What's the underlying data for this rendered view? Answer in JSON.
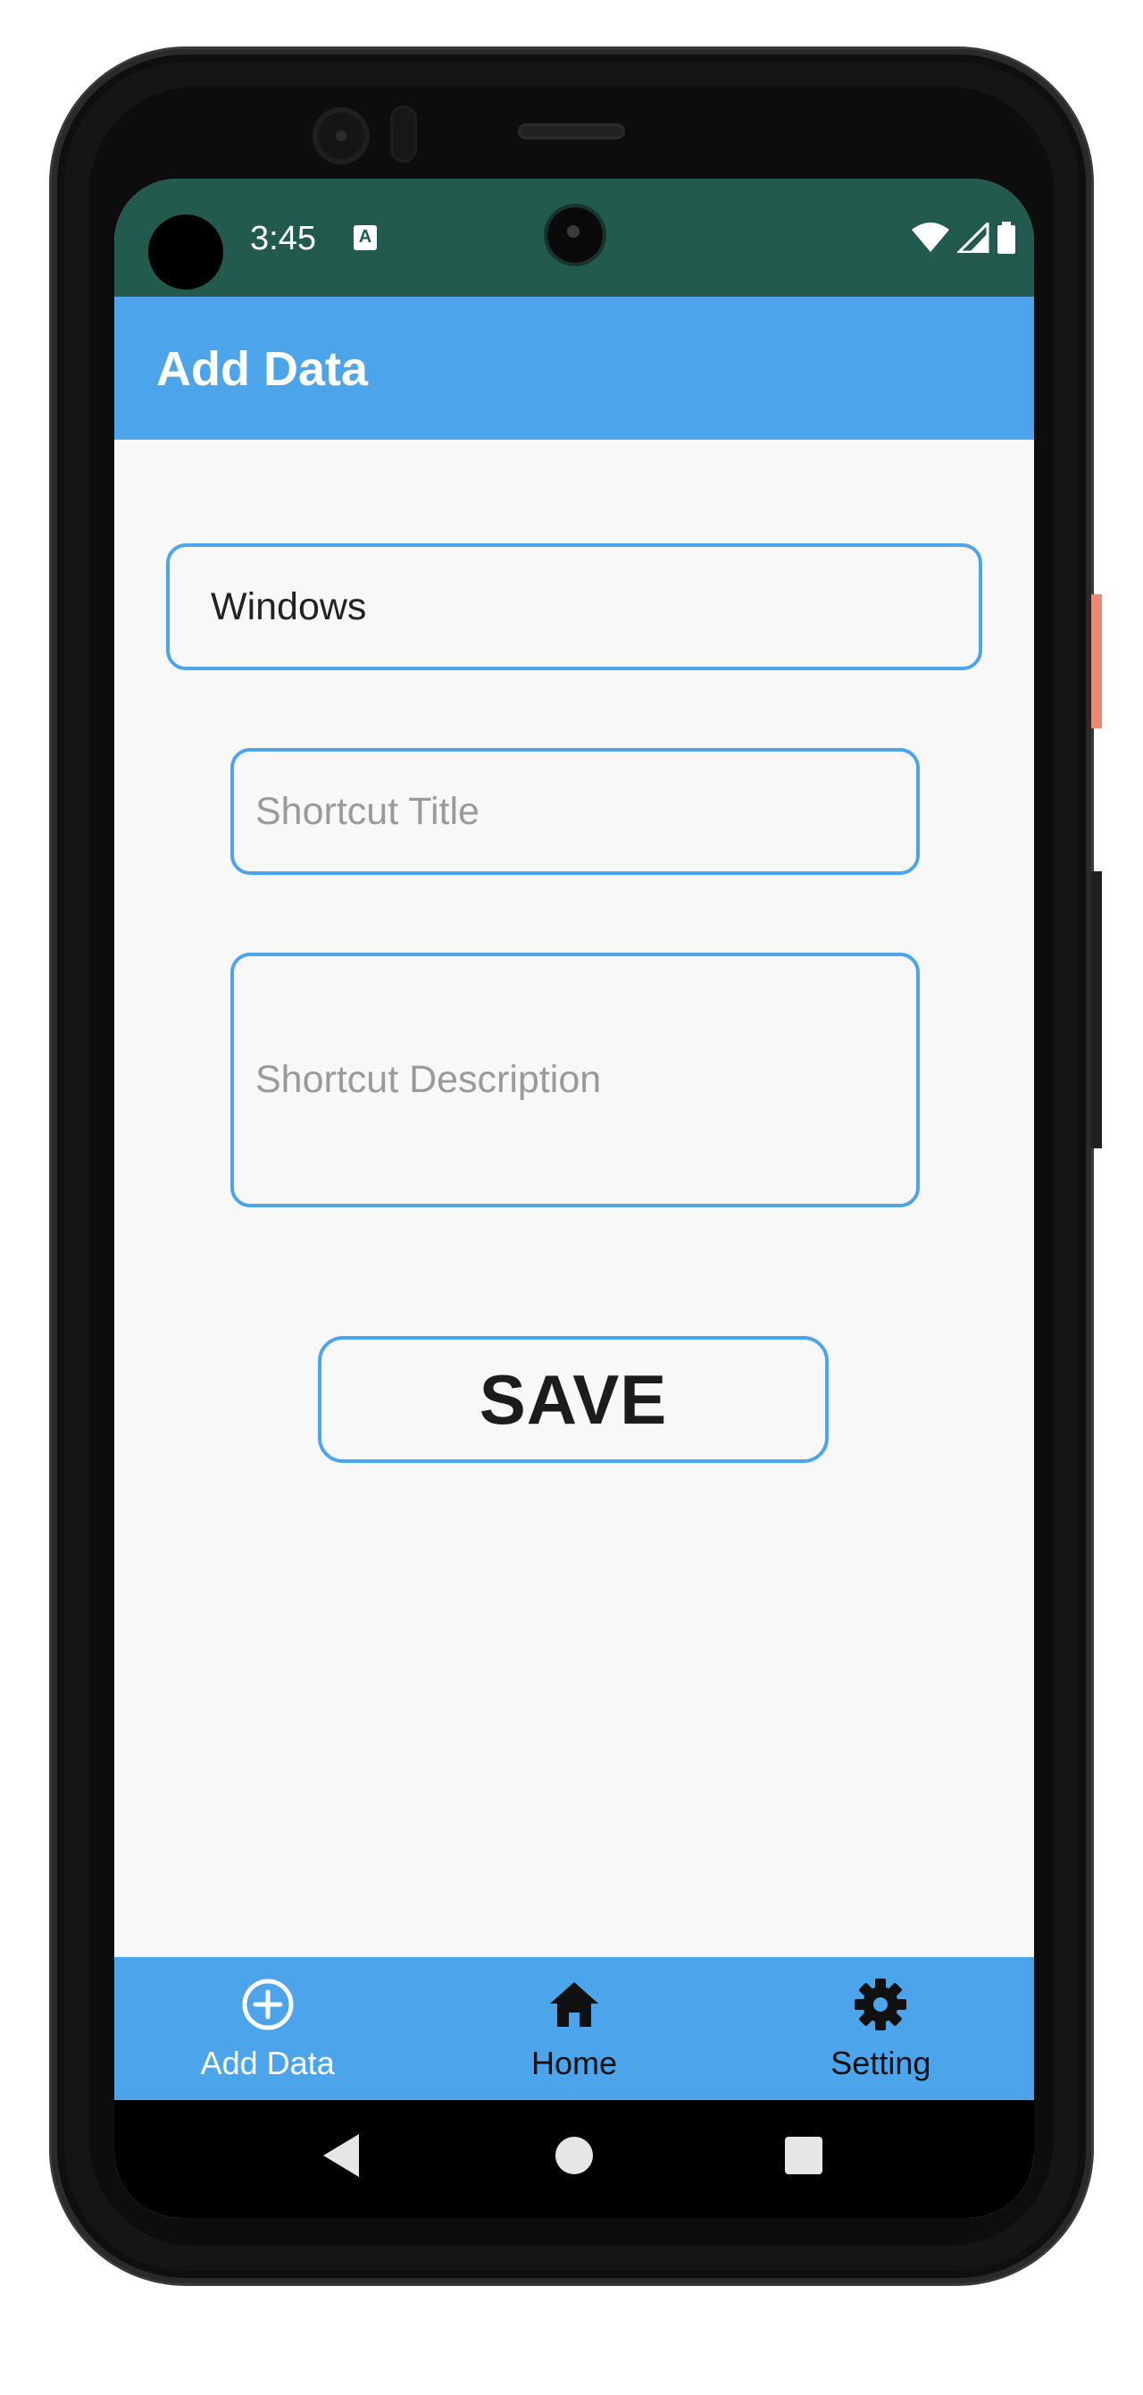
{
  "status_bar": {
    "time": "3:45",
    "keyboard_icon_letter": "A",
    "icons": [
      "wifi-icon",
      "cellular-signal-icon",
      "battery-icon"
    ],
    "background_color": "#225a4d"
  },
  "app_bar": {
    "title": "Add Data",
    "background_color": "#4ca5ea"
  },
  "form": {
    "category_value": "Windows",
    "title_placeholder": "Shortcut Title",
    "description_placeholder": "Shortcut Description",
    "save_label": "SAVE",
    "accent_color": "#4ca5ea"
  },
  "bottom_nav": {
    "items": [
      {
        "label": "Add Data",
        "icon": "add-circle-icon",
        "active": true
      },
      {
        "label": "Home",
        "icon": "home-icon",
        "active": false
      },
      {
        "label": "Setting",
        "icon": "gear-icon",
        "active": false
      }
    ]
  },
  "system_nav": {
    "buttons": [
      "back-icon",
      "home-circle-icon",
      "recents-icon"
    ]
  }
}
